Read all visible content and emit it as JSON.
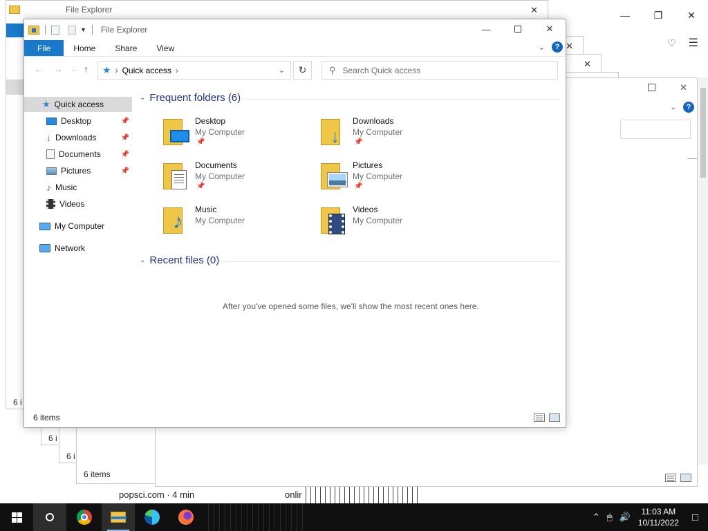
{
  "browser": {
    "bottom_text_1": "popsci.com · 4 min",
    "bottom_text_2": "onlir"
  },
  "stacked_windows": {
    "status_1": "6 i",
    "status_2": "6 i",
    "status_3": "6 i",
    "status_4": "6 items"
  },
  "explorer": {
    "title": "File Explorer",
    "tabs": {
      "file": "File",
      "home": "Home",
      "share": "Share",
      "view": "View"
    },
    "address": {
      "location": "Quick access"
    },
    "search": {
      "placeholder": "Search Quick access"
    },
    "nav": {
      "quick_access": "Quick access",
      "desktop": "Desktop",
      "downloads": "Downloads",
      "documents": "Documents",
      "pictures": "Pictures",
      "music": "Music",
      "videos": "Videos",
      "my_computer": "My Computer",
      "network": "Network"
    },
    "frequent_header": "Frequent folders (6)",
    "recent_header": "Recent files (0)",
    "recent_empty": "After you've opened some files, we'll show the most recent ones here.",
    "folders": [
      {
        "name": "Desktop",
        "location": "My Computer"
      },
      {
        "name": "Downloads",
        "location": "My Computer"
      },
      {
        "name": "Documents",
        "location": "My Computer"
      },
      {
        "name": "Pictures",
        "location": "My Computer"
      },
      {
        "name": "Music",
        "location": "My Computer"
      },
      {
        "name": "Videos",
        "location": "My Computer"
      }
    ],
    "status": "6 items"
  },
  "taskbar": {
    "time": "11:03 AM",
    "date": "10/11/2022"
  },
  "colors": {
    "file_tab": "#1979ca",
    "folder_yellow": "#f0c649",
    "group_header": "#1e3287",
    "taskbar": "#101010"
  }
}
